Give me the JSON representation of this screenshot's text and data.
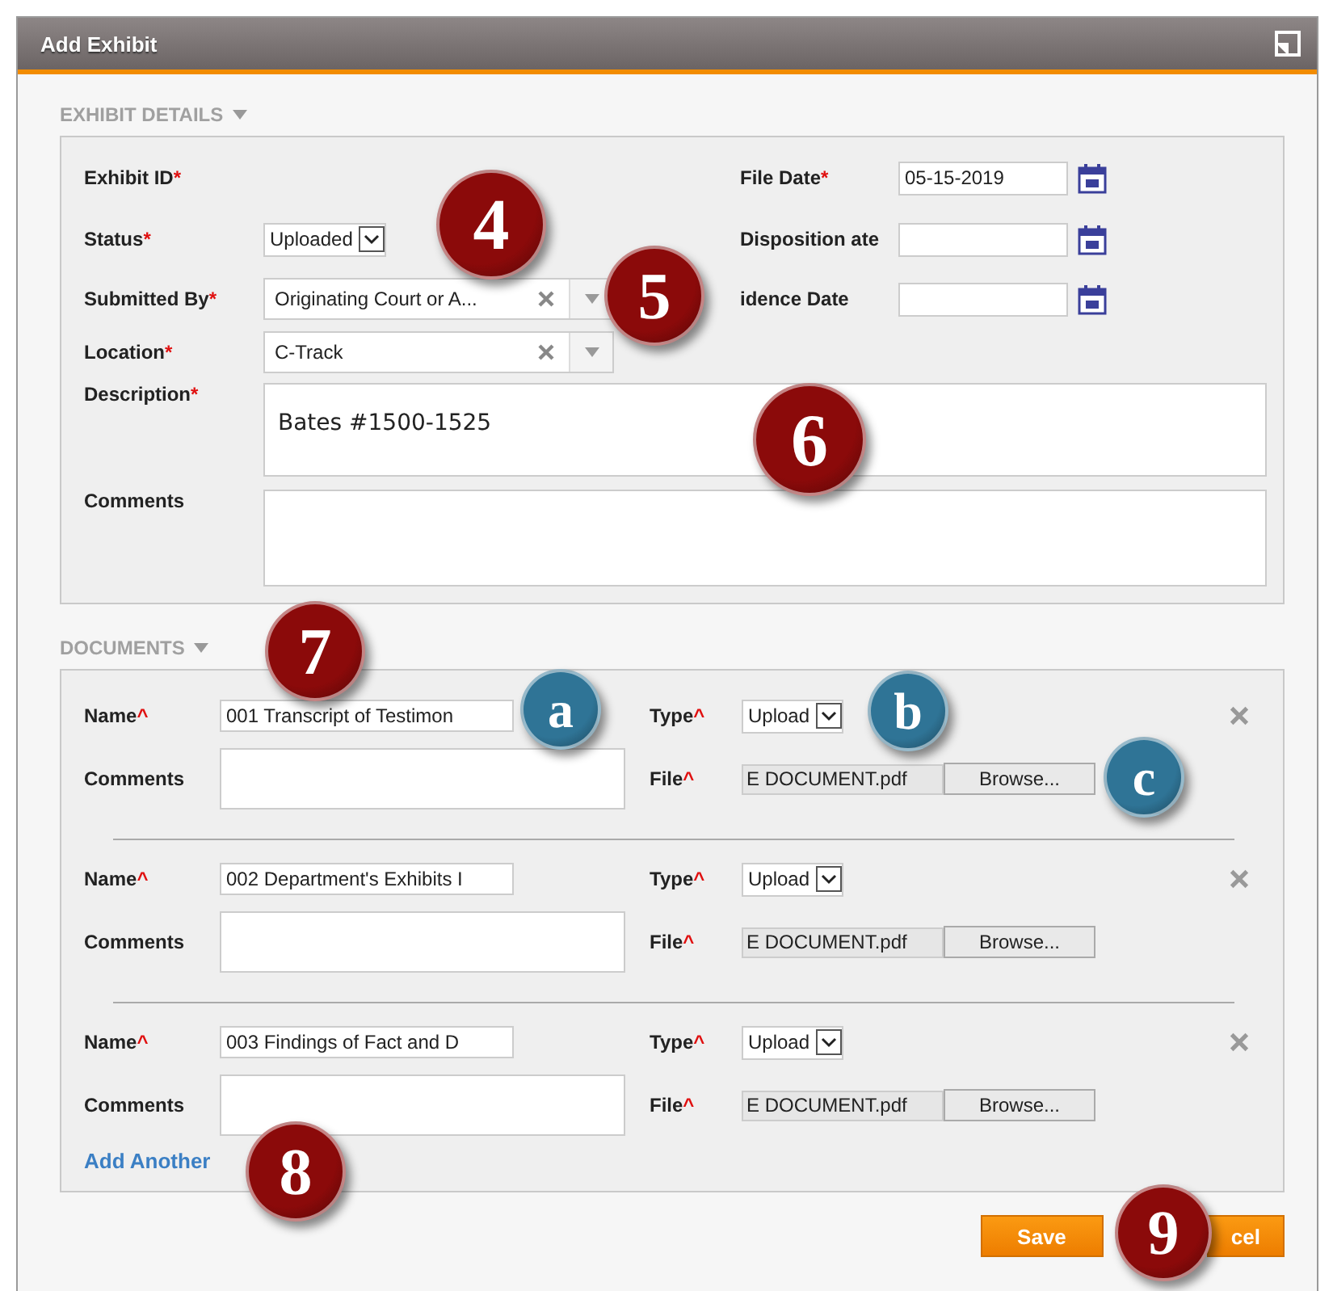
{
  "dialog": {
    "title": "Add Exhibit"
  },
  "details": {
    "heading": "EXHIBIT DETAILS",
    "left_fields": [
      {
        "label": "Exhibit ID",
        "marker": "*",
        "kind": "none"
      },
      {
        "label": "Status",
        "marker": "*",
        "kind": "select",
        "value": "Uploaded"
      },
      {
        "label": "Submitted By",
        "marker": "*",
        "kind": "combo",
        "value": "Originating Court or A..."
      },
      {
        "label": "Location",
        "marker": "*",
        "kind": "combo",
        "value": "C-Track"
      }
    ],
    "right_fields": [
      {
        "label": "File Date",
        "marker": "*",
        "value": "05-15-2019"
      },
      {
        "label": "Disposition ate"
      },
      {
        "label": "idence Date"
      }
    ],
    "description": {
      "label": "Description",
      "marker": "*",
      "value": "Bates #1500-1525"
    },
    "comments": {
      "label": "Comments"
    }
  },
  "documents": {
    "heading": "DOCUMENTS",
    "items": [
      {
        "name_label": "Name",
        "name_marker": "^",
        "name": "001 Transcript of Testimon",
        "comments_label": "Comments",
        "type_label": "Type",
        "type_marker": "^",
        "type": "Upload",
        "file_label": "File",
        "file_marker": "^",
        "file": "E DOCUMENT.pdf",
        "browse": "Browse..."
      },
      {
        "name_label": "Name",
        "name_marker": "^",
        "name": "002 Department's Exhibits I",
        "comments_label": "Comments",
        "type_label": "Type",
        "type_marker": "^",
        "type": "Upload",
        "file_label": "File",
        "file_marker": "^",
        "file": "E DOCUMENT.pdf",
        "browse": "Browse..."
      },
      {
        "name_label": "Name",
        "name_marker": "^",
        "name": "003 Findings of Fact and D",
        "comments_label": "Comments",
        "type_label": "Type",
        "type_marker": "^",
        "type": "Upload",
        "file_label": "File",
        "file_marker": "^",
        "file": "E DOCUMENT.pdf",
        "browse": "Browse..."
      }
    ],
    "add_another": "Add Another"
  },
  "buttons": [
    {
      "label": "Save"
    },
    {
      "label": "cel"
    }
  ],
  "callouts": [
    {
      "text": "4",
      "color": "#8b0a0a"
    },
    {
      "text": "5",
      "color": "#8b0a0a"
    },
    {
      "text": "6",
      "color": "#8b0a0a"
    },
    {
      "text": "7",
      "color": "#8b0a0a"
    },
    {
      "text": "a",
      "color": "#2f7496"
    },
    {
      "text": "b",
      "color": "#2f7496"
    },
    {
      "text": "c",
      "color": "#2f7496"
    },
    {
      "text": "8",
      "color": "#8b0a0a"
    },
    {
      "text": "9",
      "color": "#8b0a0a"
    }
  ]
}
